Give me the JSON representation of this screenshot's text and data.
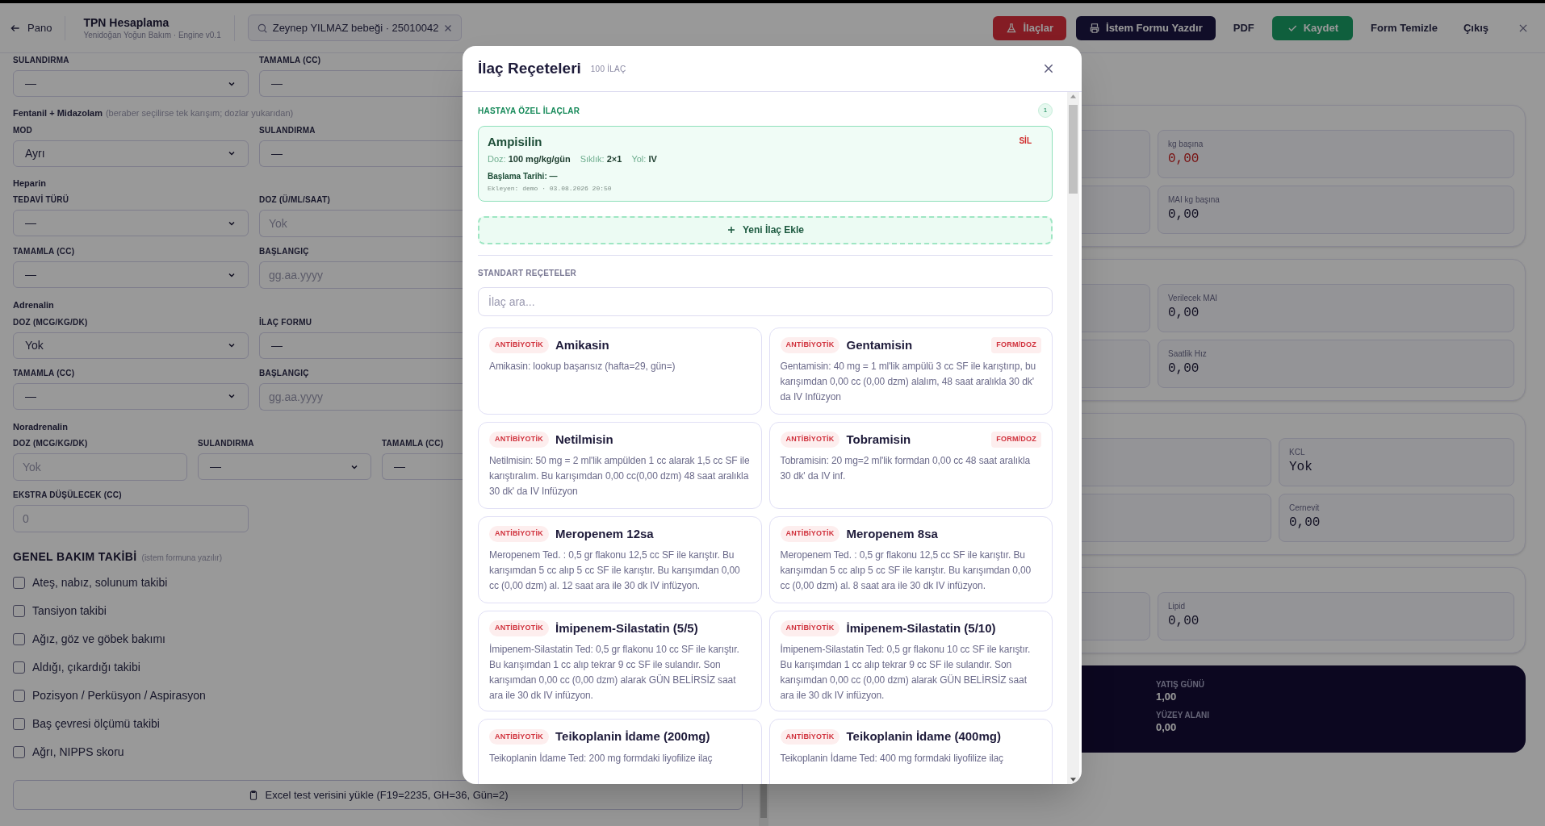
{
  "header": {
    "back": "Pano",
    "title": "TPN Hesaplama",
    "subtitle": "Yenidoğan Yoğun Bakım · Engine v0.1",
    "search_value": "Zeynep YILMAZ bebeği · 25010042",
    "actions": [
      {
        "kind": "danger",
        "label": "İlaçlar"
      },
      {
        "kind": "dark",
        "label": "İstem Formu Yazdır"
      },
      {
        "kind": "plain",
        "label": "PDF"
      },
      {
        "kind": "success",
        "label": "Kaydet"
      },
      {
        "kind": "plain",
        "label": "Form Temizle"
      },
      {
        "kind": "plain",
        "label": "Çıkış"
      }
    ]
  },
  "form": {
    "rows": [
      {
        "kind": "fields",
        "fields": [
          {
            "label": "SULANDIRMA",
            "kind": "select",
            "value": "—"
          },
          {
            "label": "TAMAMLA (CC)",
            "kind": "select",
            "value": "—"
          }
        ]
      },
      {
        "kind": "heading",
        "text": "Fentanil + Midazolam",
        "note": "(beraber seçilirse tek karışım; dozlar yukarıdan)"
      },
      {
        "kind": "fields",
        "fields": [
          {
            "label": "MOD",
            "kind": "select",
            "value": "Ayrı"
          },
          {
            "label": "SULANDIRMA",
            "kind": "select",
            "value": "—"
          }
        ]
      },
      {
        "kind": "heading",
        "text": "Heparin"
      },
      {
        "kind": "fields",
        "fields": [
          {
            "label": "TEDAVİ TÜRÜ",
            "kind": "select",
            "value": "—"
          },
          {
            "label": "DOZ (Ü/ML/SAAT)",
            "kind": "input",
            "placeholder": "Yok"
          }
        ]
      },
      {
        "kind": "fields",
        "fields": [
          {
            "label": "TAMAMLA (CC)",
            "kind": "select",
            "value": "—"
          },
          {
            "label": "BAŞLANGIÇ",
            "kind": "input",
            "placeholder": "gg.aa.yyyy"
          }
        ]
      },
      {
        "kind": "heading",
        "text": "Adrenalin"
      },
      {
        "kind": "fields",
        "fields": [
          {
            "label": "DOZ (MCG/KG/DK)",
            "kind": "select",
            "value": "Yok"
          },
          {
            "label": "İLAÇ FORMU",
            "kind": "select",
            "value": "—"
          }
        ]
      },
      {
        "kind": "fields",
        "fields": [
          {
            "label": "TAMAMLA (CC)",
            "kind": "select",
            "value": "—"
          },
          {
            "label": "BAŞLANGIÇ",
            "kind": "input",
            "placeholder": "gg.aa.yyyy"
          }
        ]
      },
      {
        "kind": "heading",
        "text": "Noradrenalin"
      },
      {
        "kind": "fields",
        "fields": [
          {
            "label": "DOZ (MCG/KG/DK)",
            "kind": "input",
            "placeholder": "Yok"
          },
          {
            "label": "SULANDIRMA",
            "kind": "select",
            "value": "—"
          },
          {
            "label": "TAMAMLA (CC)",
            "kind": "select",
            "value": "—"
          }
        ]
      },
      {
        "kind": "fields",
        "fields": [
          {
            "label": "EKSTRA DÜŞÜLECEK (CC)",
            "kind": "input",
            "placeholder": "0"
          }
        ]
      }
    ]
  },
  "care": {
    "title": "GENEL BAKIM TAKİBİ",
    "note": "(istem formuna yazılır)",
    "items": [
      {
        "label": "Ateş, nabız, solunum takibi",
        "checked": false
      },
      {
        "label": "Tansiyon takibi",
        "checked": false
      },
      {
        "label": "Ağız, göz ve göbek bakımı",
        "checked": false
      },
      {
        "label": "Aldığı, çıkardığı takibi",
        "checked": false
      },
      {
        "label": "Pozisyon / Perküsyon / Aspirasyon",
        "checked": false
      },
      {
        "label": "Baş çevresi ölçümü takibi",
        "checked": false
      },
      {
        "label": "Ağrı, NIPPS skoru",
        "checked": false
      }
    ]
  },
  "excel_button": "Excel test verisini yükle (F19=2235, GH=36, Gün=2)",
  "results": {
    "cards": [
      {
        "kind": "two_column",
        "stats": [
          {
            "label": "kg başına",
            "value": "0,00",
            "alert": true
          },
          {
            "label": "MAI kg başına",
            "value": "0,00",
            "alert": false
          }
        ]
      },
      {
        "kind": "two_column",
        "stats": [
          {
            "label": "Verilecek MAI",
            "value": "0,00",
            "alert": false
          },
          {
            "label": "Saatlik Hız",
            "value": "0,00",
            "alert": false
          }
        ]
      },
      {
        "kind": "three_column",
        "stats": [
          {
            "label": "KCL",
            "value": "Yok",
            "alert": false
          },
          {
            "label": "Cernevit",
            "value": "0,00",
            "alert": false
          }
        ]
      },
      {
        "kind": "two_column",
        "stats": [
          {
            "label": "Lipid",
            "value": "0,00",
            "alert": false
          }
        ]
      }
    ],
    "summary": [
      {
        "label": "YATIŞ GÜNÜ",
        "value": "1,00"
      },
      {
        "label": "YÜZEY ALANI",
        "value": "0,00"
      }
    ]
  },
  "modal": {
    "title": "İlaç Reçeteleri",
    "count": "100 İLAÇ",
    "patient_section": {
      "title": "HASTAYA ÖZEL İLAÇLAR",
      "count": "1",
      "drugs": [
        {
          "name": "Ampisilin",
          "remove": "SİL",
          "details": [
            "Doz: **100 mg/kg/gün**",
            "Sıklık: **2×1**",
            "Yol: **IV**"
          ],
          "start": "Başlama Tarihi: —",
          "added_by": "Ekleyen: demo · 03.08.2026 20:50"
        }
      ]
    },
    "add_button": "Yeni İlaç Ekle",
    "standard_title": "STANDART REÇETELER",
    "search_placeholder": "İlaç ara...",
    "recipes": [
      {
        "tag": "ANTİBİYOTİK",
        "name": "Amikasin",
        "text": "Amikasin: lookup başarısız (hafta=29, gün=)"
      },
      {
        "tag": "ANTİBİYOTİK",
        "name": "Gentamisin",
        "flag": "FORM/DOZ",
        "text": "Gentamisin: 40 mg = 1 ml'lik ampülü 3 cc SF ile karıştırıp, bu karışımdan 0,00 cc (0,00 dzm) alalım, 48 saat aralıkla 30 dk' da IV Infüzyon"
      },
      {
        "tag": "ANTİBİYOTİK",
        "name": "Netilmisin",
        "text": "Netilmisin: 50 mg = 2 ml'lik ampülden 1 cc alarak 1,5 cc SF ile karıştıralım. Bu karışımdan 0,00 cc(0,00 dzm) 48 saat aralıkla 30 dk' da IV Infüzyon"
      },
      {
        "tag": "ANTİBİYOTİK",
        "name": "Tobramisin",
        "flag": "FORM/DOZ",
        "text": "Tobramisin: 20 mg=2 ml'lik formdan 0,00 cc 48 saat aralıkla 30 dk' da IV inf."
      },
      {
        "tag": "ANTİBİYOTİK",
        "name": "Meropenem 12sa",
        "text": "Meropenem Ted. : 0,5 gr flakonu 12,5 cc SF ile karıştır. Bu karışımdan 5 cc alıp 5 cc SF ile karıştır. Bu karışımdan 0,00 cc (0,00 dzm) al. 12 saat ara ile 30 dk IV infüzyon."
      },
      {
        "tag": "ANTİBİYOTİK",
        "name": "Meropenem 8sa",
        "text": "Meropenem Ted. : 0,5 gr flakonu 12,5 cc SF ile karıştır. Bu karışımdan 5 cc alıp 5 cc SF ile karıştır. Bu karışımdan 0,00 cc (0,00 dzm) al. 8 saat ara ile 30 dk IV infüzyon."
      },
      {
        "tag": "ANTİBİYOTİK",
        "name": "İmipenem-Silastatin (5/5)",
        "text": "İmipenem-Silastatin Ted: 0,5 gr flakonu 10 cc SF ile karıştır. Bu karışımdan 1 cc alıp tekrar 9 cc SF ile sulandır. Son karışımdan 0,00 cc (0,00 dzm) alarak GÜN BELİRSİZ saat ara ile 30 dk IV infüzyon."
      },
      {
        "tag": "ANTİBİYOTİK",
        "name": "İmipenem-Silastatin (5/10)",
        "text": "İmipenem-Silastatin Ted: 0,5 gr flakonu 10 cc SF ile karıştır. Bu karışımdan 1 cc alıp tekrar 9 cc SF ile sulandır. Son karışımdan 0,00 cc (0,00 dzm) alarak GÜN BELİRSİZ saat ara ile 30 dk IV infüzyon."
      },
      {
        "tag": "ANTİBİYOTİK",
        "name": "Teikoplanin İdame (200mg)",
        "text": "Teikoplanin İdame Ted: 200 mg formdaki liyofilize ilaç"
      },
      {
        "tag": "ANTİBİYOTİK",
        "name": "Teikoplanin İdame (400mg)",
        "text": "Teikoplanin İdame Ted: 400 mg formdaki liyofilize ilaç"
      }
    ]
  }
}
